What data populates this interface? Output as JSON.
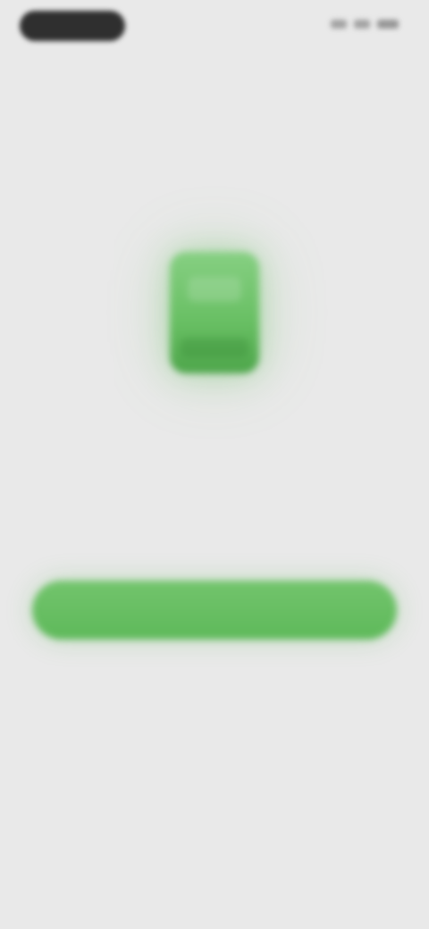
{
  "status_bar": {
    "time": "",
    "icons": [
      "signal-icon",
      "wifi-icon",
      "battery-icon"
    ]
  },
  "main": {
    "hero_icon": "device-icon",
    "headline": "",
    "description": "",
    "primary_button_label": ""
  },
  "colors": {
    "background": "#e9e9e9",
    "accent": "#5eb95a"
  }
}
